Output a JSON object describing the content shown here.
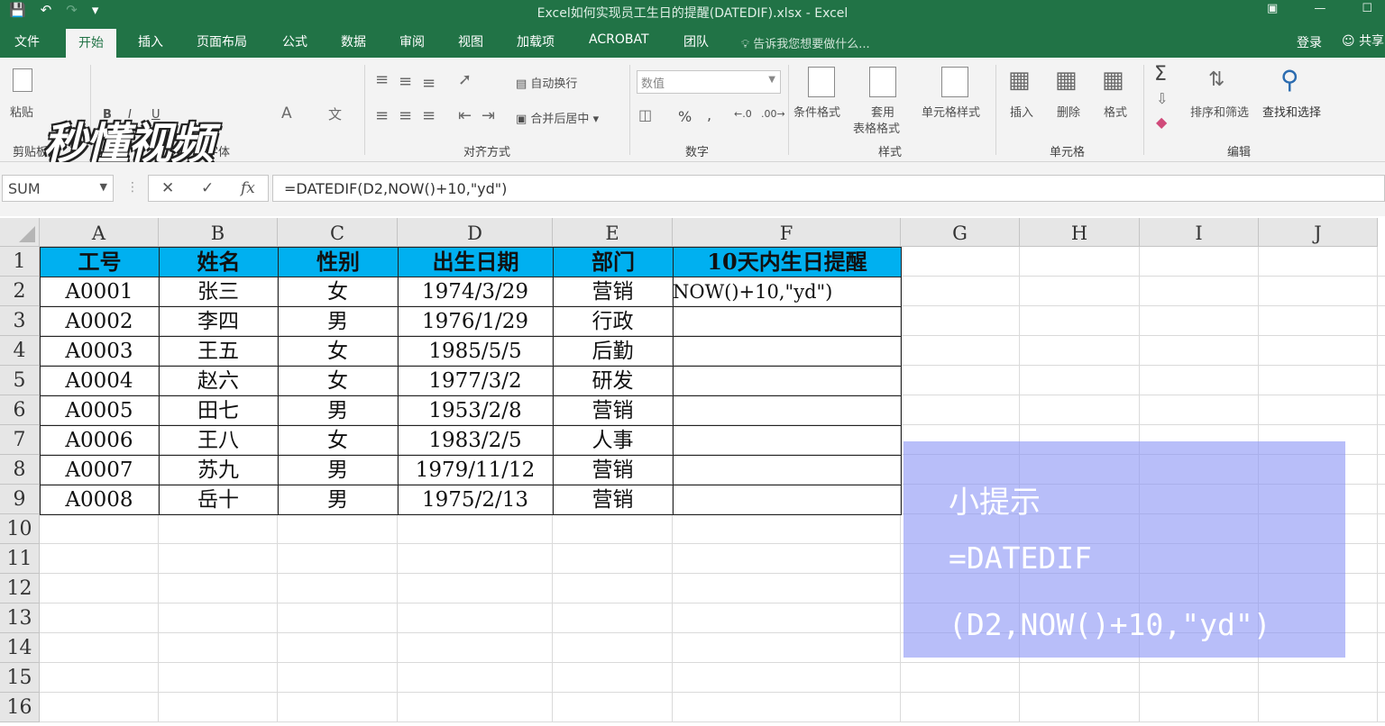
{
  "window": {
    "title": "Excel如何实现员工生日的提醒(DATEDIF).xlsx - Excel"
  },
  "tabs": [
    {
      "label": "文件"
    },
    {
      "label": "开始"
    },
    {
      "label": "插入"
    },
    {
      "label": "页面布局"
    },
    {
      "label": "公式"
    },
    {
      "label": "数据"
    },
    {
      "label": "审阅"
    },
    {
      "label": "视图"
    },
    {
      "label": "加载项"
    },
    {
      "label": "ACROBAT"
    },
    {
      "label": "团队"
    }
  ],
  "tellme": "告诉我您想要做什么...",
  "account": {
    "login": "登录",
    "share": "共享"
  },
  "watermark": "秒懂视频",
  "ribbon": {
    "paste": "粘贴",
    "clipboard_group": "剪贴板",
    "font_group": "字体",
    "bold": "B",
    "italic": "I",
    "underline": "U",
    "wrap_text": "自动换行",
    "merge_center": "合并后居中",
    "align_group": "对齐方式",
    "number_format": "数值",
    "percent": "%",
    "comma": ",",
    "number_group": "数字",
    "cond_format": "条件格式",
    "table_format_1": "套用",
    "table_format_2": "表格格式",
    "cell_styles": "单元格样式",
    "styles_group": "样式",
    "insert": "插入",
    "delete": "删除",
    "format": "格式",
    "cells_group": "单元格",
    "sort_filter": "排序和筛选",
    "find_select": "查找和选择",
    "edit_group": "编辑"
  },
  "formula_bar": {
    "name_box": "SUM",
    "formula": "=DATEDIF(D2,NOW()+10,\"yd\")"
  },
  "sheet": {
    "columns": [
      "A",
      "B",
      "C",
      "D",
      "E",
      "F",
      "G",
      "H",
      "I",
      "J"
    ],
    "rows": [
      "1",
      "2",
      "3",
      "4",
      "5",
      "6",
      "7",
      "8",
      "9",
      "10",
      "11",
      "12",
      "13",
      "14",
      "15",
      "16"
    ],
    "headers": [
      "工号",
      "姓名",
      "性别",
      "出生日期",
      "部门",
      "10天内生日提醒"
    ],
    "data": [
      [
        "A0001",
        "张三",
        "女",
        "1974/3/29",
        "营销"
      ],
      [
        "A0002",
        "李四",
        "男",
        "1976/1/29",
        "行政"
      ],
      [
        "A0003",
        "王五",
        "女",
        "1985/5/5",
        "后勤"
      ],
      [
        "A0004",
        "赵六",
        "女",
        "1977/3/2",
        "研发"
      ],
      [
        "A0005",
        "田七",
        "男",
        "1953/2/8",
        "营销"
      ],
      [
        "A0006",
        "王八",
        "女",
        "1983/2/5",
        "人事"
      ],
      [
        "A0007",
        "苏九",
        "男",
        "1979/11/12",
        "营销"
      ],
      [
        "A0008",
        "岳十",
        "男",
        "1975/2/13",
        "营销"
      ]
    ],
    "f2_editing": "NOW()+10,\"yd\")"
  },
  "tip": {
    "title": "小提示",
    "line1": "=DATEDIF",
    "line2": "(D2,NOW()+10,\"yd\")"
  }
}
